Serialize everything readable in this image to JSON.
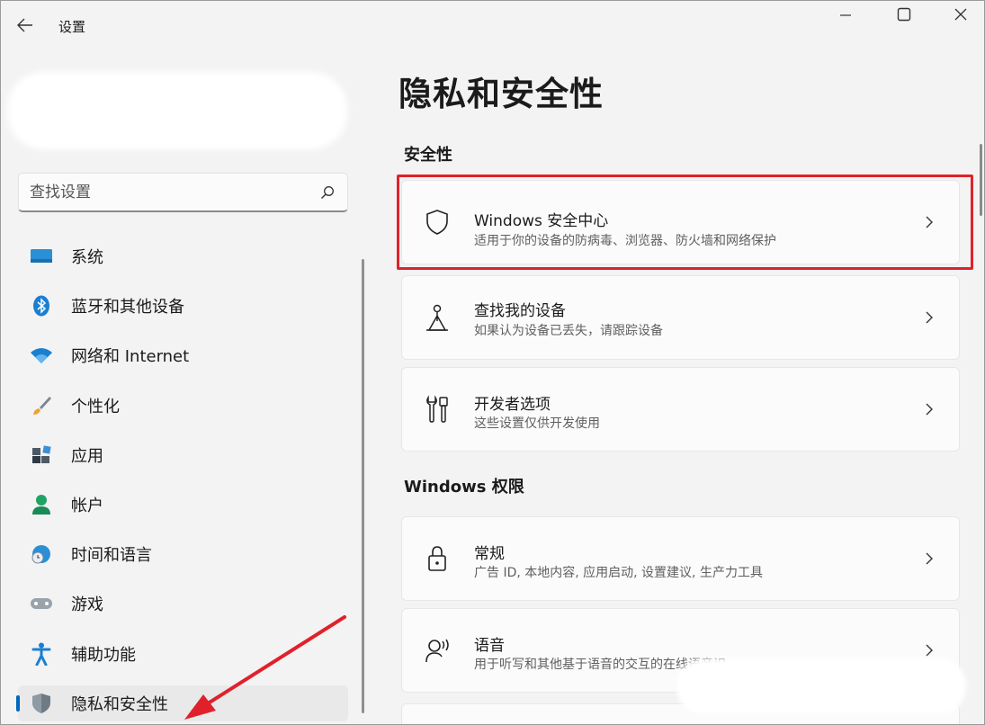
{
  "app": {
    "title": "设置"
  },
  "search": {
    "placeholder": "查找设置"
  },
  "sidebar": {
    "items": [
      {
        "label": "系统",
        "icon": "monitor-icon"
      },
      {
        "label": "蓝牙和其他设备",
        "icon": "bluetooth-icon"
      },
      {
        "label": "网络和 Internet",
        "icon": "wifi-icon"
      },
      {
        "label": "个性化",
        "icon": "brush-icon"
      },
      {
        "label": "应用",
        "icon": "apps-icon"
      },
      {
        "label": "帐户",
        "icon": "user-icon"
      },
      {
        "label": "时间和语言",
        "icon": "globe-clock-icon"
      },
      {
        "label": "游戏",
        "icon": "gamepad-icon"
      },
      {
        "label": "辅助功能",
        "icon": "accessibility-icon"
      },
      {
        "label": "隐私和安全性",
        "icon": "shield-icon",
        "selected": true
      }
    ]
  },
  "main": {
    "title": "隐私和安全性",
    "sections": [
      {
        "header": "安全性",
        "cards": [
          {
            "title": "Windows 安全中心",
            "desc": "适用于你的设备的防病毒、浏览器、防火墙和网络保护",
            "icon": "shield-icon"
          },
          {
            "title": "查找我的设备",
            "desc": "如果认为设备已丢失，请跟踪设备",
            "icon": "find-device-icon"
          },
          {
            "title": "开发者选项",
            "desc": "这些设置仅供开发使用",
            "icon": "developer-tools-icon"
          }
        ]
      },
      {
        "header": "Windows 权限",
        "cards": [
          {
            "title": "常规",
            "desc": "广告 ID, 本地内容, 应用启动, 设置建议, 生产力工具",
            "icon": "lock-icon"
          },
          {
            "title": "语音",
            "desc": "用于听写和其他基于语音的交互的在线语音识",
            "icon": "speech-icon"
          }
        ]
      }
    ]
  },
  "colors": {
    "accent": "#0067c0",
    "highlight": "#e0212b"
  }
}
